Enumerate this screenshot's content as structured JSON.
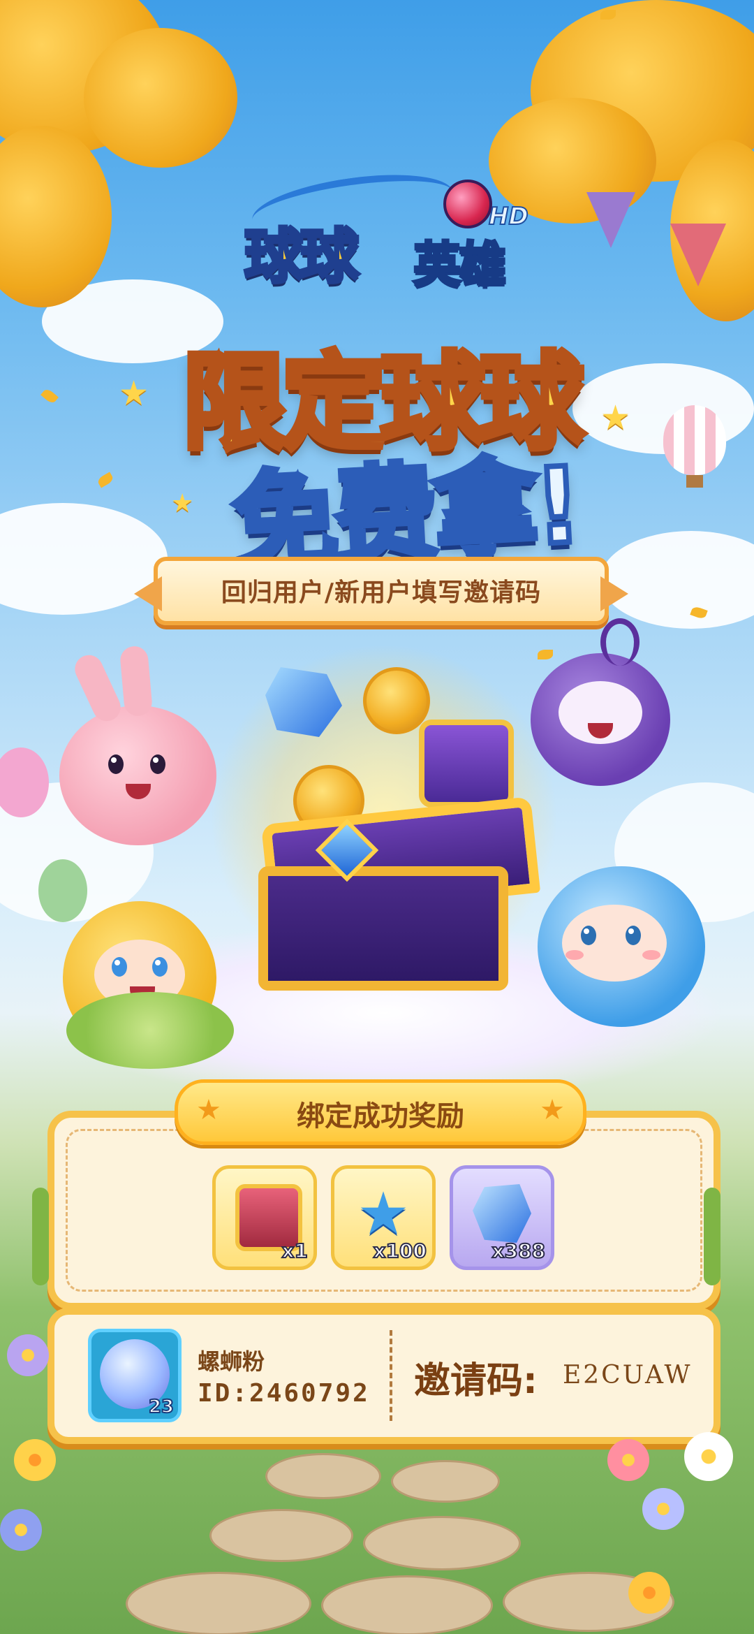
{
  "logo": {
    "main": "球球",
    "sub": "英雄",
    "hd": "HD"
  },
  "headline": {
    "line1": "限定球球",
    "line2": "免费拿!"
  },
  "banner": {
    "text": "回归用户/新用户填写邀请码"
  },
  "rewards": {
    "title": "绑定成功奖励",
    "items": [
      {
        "icon": "treasure-chest-icon",
        "count": "x1"
      },
      {
        "icon": "star-icon",
        "count": "x100"
      },
      {
        "icon": "crystal-gems-icon",
        "count": "x388"
      }
    ]
  },
  "user": {
    "name": "螺蛳粉",
    "id": "ID:2460792",
    "level": "23",
    "invite_label": "邀请码:",
    "invite_code": "E2CUAW"
  },
  "colors": {
    "accent": "#f6c24a",
    "text_brown": "#7a4618",
    "sky": "#3f9ee8"
  }
}
